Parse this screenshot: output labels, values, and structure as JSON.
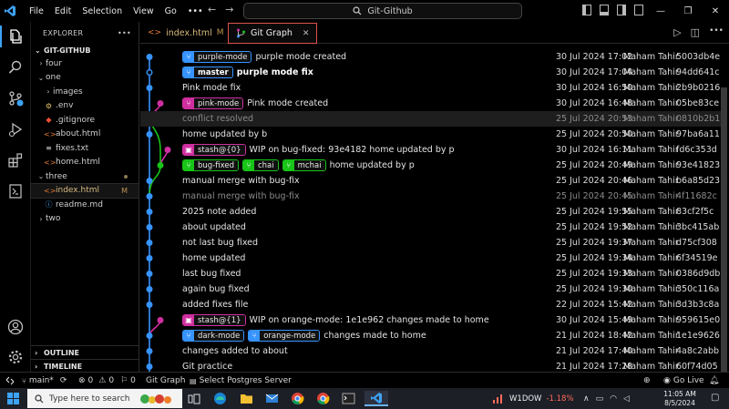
{
  "titlebar": {
    "menu": [
      "File",
      "Edit",
      "Selection",
      "View",
      "Go"
    ],
    "more": "•••",
    "back_arrow": "←",
    "forward_arrow": "→",
    "search_text": "Git-Github",
    "minimize": "—",
    "restore": "❐",
    "close": "✕"
  },
  "activitybar": {
    "items": [
      "explorer-icon",
      "search-icon",
      "source-control-icon",
      "run-debug-icon",
      "extensions-icon",
      "remote-icon"
    ],
    "bottom": [
      "account-icon",
      "gear-icon"
    ]
  },
  "sidebar": {
    "title": "EXPLORER",
    "more": "•••",
    "repo": "GIT-GITHUB",
    "items": [
      {
        "name": "four",
        "type": "folder",
        "expanded": false,
        "depth": 1
      },
      {
        "name": "one",
        "type": "folder",
        "expanded": true,
        "depth": 1
      },
      {
        "name": "images",
        "type": "folder",
        "expanded": false,
        "depth": 2
      },
      {
        "name": ".env",
        "type": "env",
        "depth": 2
      },
      {
        "name": ".gitignore",
        "type": "git",
        "depth": 2
      },
      {
        "name": "about.html",
        "type": "html",
        "depth": 2
      },
      {
        "name": "fixes.txt",
        "type": "txt",
        "depth": 2
      },
      {
        "name": "home.html",
        "type": "html",
        "depth": 2
      },
      {
        "name": "three",
        "type": "folder",
        "expanded": true,
        "depth": 1,
        "modified_dot": true
      },
      {
        "name": "index.html",
        "type": "html",
        "depth": 2,
        "badge": "M",
        "selected": true
      },
      {
        "name": "readme.md",
        "type": "md",
        "depth": 2
      },
      {
        "name": "two",
        "type": "folder",
        "expanded": false,
        "depth": 1
      }
    ],
    "outline": "OUTLINE",
    "timeline": "TIMELINE"
  },
  "tabs": [
    {
      "label": "index.html",
      "badge": "M",
      "active": false
    },
    {
      "label": "Git Graph",
      "active": true,
      "close": "✕"
    }
  ],
  "commits": [
    {
      "refs": [
        {
          "name": "purple-mode",
          "kind": "branch",
          "color": "#3794ff"
        }
      ],
      "message": "purple mode created",
      "date": "30 Jul 2024 17:02",
      "author": "Maham Tahir",
      "hash": "5003db4e"
    },
    {
      "refs": [
        {
          "name": "master",
          "kind": "branch",
          "color": "#3794ff",
          "head": true
        }
      ],
      "message": "purple mode fix",
      "bold": true,
      "date": "30 Jul 2024 17:04",
      "author": "Maham Tahir",
      "hash": "94dd641c"
    },
    {
      "refs": [],
      "message": "Pink mode fix",
      "date": "30 Jul 2024 16:50",
      "author": "Maham Tahir",
      "hash": "2b9b0216"
    },
    {
      "refs": [
        {
          "name": "pink-mode",
          "kind": "branch",
          "color": "#d02fa0"
        }
      ],
      "message": "Pink mode created",
      "date": "30 Jul 2024 16:48",
      "author": "Maham Tahir",
      "hash": "05be83ce"
    },
    {
      "refs": [],
      "message": "conflict resolved",
      "dim": true,
      "highlight": true,
      "date": "25 Jul 2024 20:53",
      "author": "Maham Tahir",
      "hash": "0810b2b1"
    },
    {
      "refs": [],
      "message": "home updated by b",
      "date": "25 Jul 2024 20:50",
      "author": "Maham Tahir",
      "hash": "97ba6a11"
    },
    {
      "refs": [
        {
          "name": "stash@{0}",
          "kind": "stash",
          "color": "#d02fa0"
        }
      ],
      "message": "WIP on bug-fixed: 93e4182 home updated by p",
      "date": "30 Jul 2024 16:11",
      "author": "Maham Tahir",
      "hash": "fd6c353d"
    },
    {
      "refs": [
        {
          "name": "bug-fixed",
          "kind": "branch",
          "color": "#18c418"
        },
        {
          "name": "chai",
          "kind": "branch",
          "color": "#18c418"
        },
        {
          "name": "mchai",
          "kind": "branch",
          "color": "#18c418"
        }
      ],
      "message": "home updated by p",
      "date": "25 Jul 2024 20:49",
      "author": "Maham Tahir",
      "hash": "93e41823"
    },
    {
      "refs": [],
      "message": "manual merge with bug-fix",
      "date": "25 Jul 2024 20:46",
      "author": "Maham Tahir",
      "hash": "b6a85d23"
    },
    {
      "refs": [],
      "message": "manual merge with bug-fix",
      "dim": true,
      "date": "25 Jul 2024 20:45",
      "author": "Maham Tahir",
      "hash": "4f11682c"
    },
    {
      "refs": [],
      "message": "2025 note added",
      "date": "25 Jul 2024 19:55",
      "author": "Maham Tahir",
      "hash": "83cf2f5c"
    },
    {
      "refs": [],
      "message": "about updated",
      "date": "25 Jul 2024 19:52",
      "author": "Maham Tahir",
      "hash": "3bc415ab"
    },
    {
      "refs": [],
      "message": "not last bug fixed",
      "date": "25 Jul 2024 19:37",
      "author": "Maham Tahir",
      "hash": "d75cf308"
    },
    {
      "refs": [],
      "message": "home updated",
      "date": "25 Jul 2024 19:34",
      "author": "Maham Tahir",
      "hash": "6f34519e"
    },
    {
      "refs": [],
      "message": "last bug fixed",
      "date": "25 Jul 2024 19:33",
      "author": "Maham Tahir",
      "hash": "0386d9db"
    },
    {
      "refs": [],
      "message": "again bug fixed",
      "date": "25 Jul 2024 19:30",
      "author": "Maham Tahir",
      "hash": "350c116a"
    },
    {
      "refs": [],
      "message": "added fixes file",
      "date": "22 Jul 2024 15:42",
      "author": "Maham Tahir",
      "hash": "3d3b3c8a"
    },
    {
      "refs": [
        {
          "name": "stash@{1}",
          "kind": "stash",
          "color": "#d02fa0"
        }
      ],
      "message": "WIP on orange-mode: 1e1e962 changes made to home",
      "date": "30 Jul 2024 15:49",
      "author": "Maham Tahir",
      "hash": "959615e0"
    },
    {
      "refs": [
        {
          "name": "dark-mode",
          "kind": "branch",
          "color": "#3794ff"
        },
        {
          "name": "orange-mode",
          "kind": "branch",
          "color": "#3794ff"
        }
      ],
      "message": "changes made to home",
      "date": "21 Jul 2024 18:42",
      "author": "Maham Tahir",
      "hash": "1e1e9626"
    },
    {
      "refs": [],
      "message": "changes added to about",
      "date": "21 Jul 2024 17:40",
      "author": "Maham Tahir",
      "hash": "4a8c2abb"
    },
    {
      "refs": [],
      "message": "Git practice",
      "date": "21 Jul 2024 17:28",
      "author": "Maham Tahir",
      "hash": "60f74d05"
    }
  ],
  "statusbar": {
    "branch": "main*",
    "errors": "0",
    "warnings": "0",
    "info": "0",
    "git_graph": "Git Graph",
    "postgres": "Select Postgres Server",
    "go_live": "Go Live"
  },
  "taskbar": {
    "search_placeholder": "Type here to search",
    "stock_name": "W1DOW",
    "stock_change": "-1.18%",
    "time": "11:05 AM",
    "date": "8/5/2024"
  }
}
